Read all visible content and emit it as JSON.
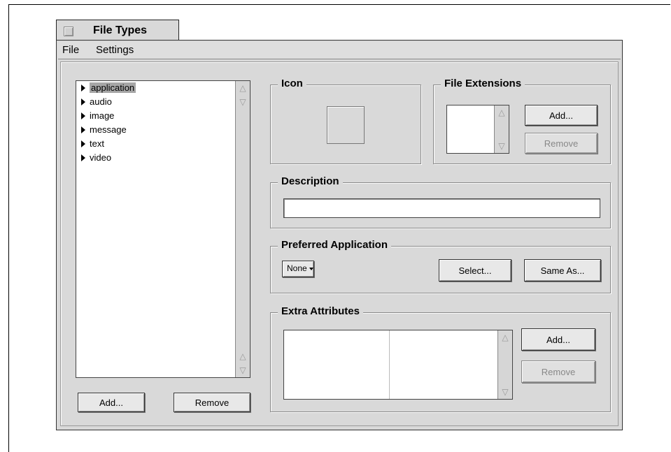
{
  "window": {
    "title": "File Types"
  },
  "menubar": {
    "items": [
      "File",
      "Settings"
    ]
  },
  "type_list": {
    "items": [
      {
        "label": "application",
        "selected": true
      },
      {
        "label": "audio",
        "selected": false
      },
      {
        "label": "image",
        "selected": false
      },
      {
        "label": "message",
        "selected": false
      },
      {
        "label": "text",
        "selected": false
      },
      {
        "label": "video",
        "selected": false
      }
    ],
    "add_label": "Add...",
    "remove_label": "Remove"
  },
  "icon_group": {
    "title": "Icon"
  },
  "extensions_group": {
    "title": "File Extensions",
    "add_label": "Add...",
    "remove_label": "Remove"
  },
  "description_group": {
    "title": "Description",
    "value": ""
  },
  "preferred_group": {
    "title": "Preferred Application",
    "selected_app": "None",
    "select_label": "Select...",
    "same_as_label": "Same As..."
  },
  "attributes_group": {
    "title": "Extra Attributes",
    "add_label": "Add...",
    "remove_label": "Remove"
  },
  "icons": {
    "scroll_up": "△",
    "scroll_down": "▽"
  }
}
